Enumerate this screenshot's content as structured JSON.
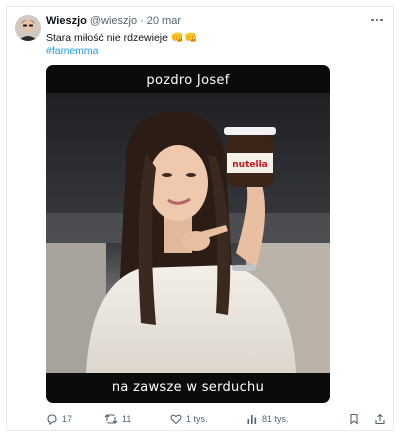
{
  "tweet": {
    "author_name": "Wieszjo",
    "author_handle": "@wieszjo",
    "separator": "·",
    "date": "20 mar",
    "text": "Stara miłość nie rdzewieje 👊👊",
    "hashtag": "#famemma"
  },
  "media": {
    "caption_top": "pozdro Josef",
    "caption_bottom": "na zawsze w serduchu",
    "jar_label": "nutella"
  },
  "actions": {
    "replies": "17",
    "retweets": "11",
    "likes": "1 tys.",
    "views": "81 tys."
  },
  "colors": {
    "link": "#1d9bf0",
    "muted": "#536471",
    "text": "#0f1419"
  },
  "icons": [
    "more-icon",
    "reply-icon",
    "retweet-icon",
    "like-icon",
    "views-icon",
    "bookmark-icon",
    "share-icon"
  ]
}
